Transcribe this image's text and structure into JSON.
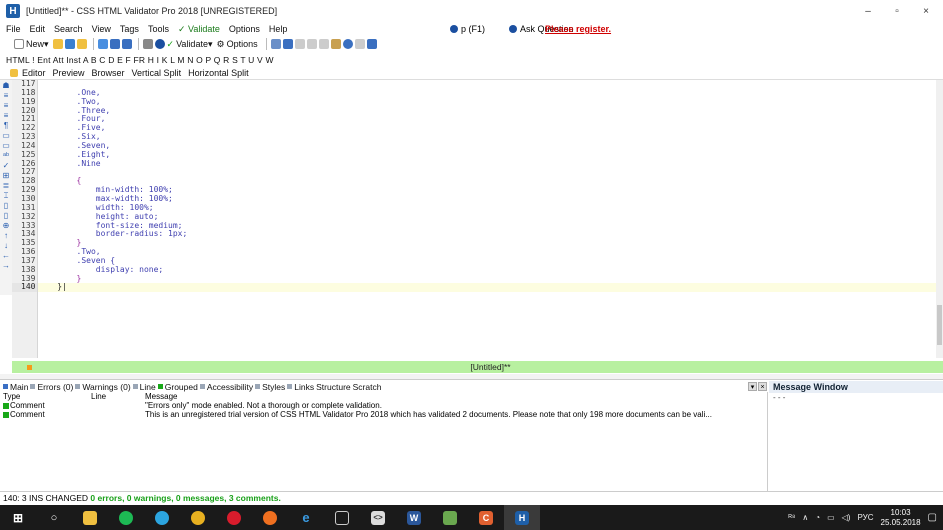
{
  "window": {
    "title": "[Untitled]** - CSS HTML Validator Pro 2018 [UNREGISTERED]",
    "app_icon_letter": "H",
    "minimize": "–",
    "maximize": "▫",
    "close": "×"
  },
  "menu": {
    "items": [
      "File",
      "Edit",
      "Search",
      "View",
      "Tags",
      "Tools",
      "✓ Validate",
      "Options",
      "Help"
    ],
    "p_label": "p (F1)",
    "ask_question": "Ask Question",
    "register": "Please register."
  },
  "toolbar": {
    "new_label": "New",
    "validate_label": "Validate",
    "options_label": "Options"
  },
  "letterbar": {
    "text": "HTML ! Ent Att Inst A B C D E F FR H I K L M N O P Q R S T U V W"
  },
  "tabs": [
    "Editor",
    "Preview",
    "Browser",
    "Vertical Split",
    "Horizontal Split"
  ],
  "editor": {
    "lines": [
      {
        "num": "117",
        "text": ""
      },
      {
        "num": "118",
        "text": "        .One,"
      },
      {
        "num": "119",
        "text": "        .Two,"
      },
      {
        "num": "120",
        "text": "        .Three,"
      },
      {
        "num": "121",
        "text": "        .Four,"
      },
      {
        "num": "122",
        "text": "        .Five,"
      },
      {
        "num": "123",
        "text": "        .Six,"
      },
      {
        "num": "124",
        "text": "        .Seven,"
      },
      {
        "num": "125",
        "text": "        .Eight,"
      },
      {
        "num": "126",
        "text": "        .Nine"
      },
      {
        "num": "127",
        "text": ""
      },
      {
        "num": "128",
        "text": "        {"
      },
      {
        "num": "129",
        "text": "            min-width: 100%;"
      },
      {
        "num": "130",
        "text": "            max-width: 100%;"
      },
      {
        "num": "131",
        "text": "            width: 100%;"
      },
      {
        "num": "132",
        "text": "            height: auto;"
      },
      {
        "num": "133",
        "text": "            font-size: medium;"
      },
      {
        "num": "134",
        "text": "            border-radius: 1px;"
      },
      {
        "num": "135",
        "text": "        }"
      },
      {
        "num": "136",
        "text": "        .Two,"
      },
      {
        "num": "137",
        "text": "        .Seven {"
      },
      {
        "num": "138",
        "text": "            display: none;"
      },
      {
        "num": "139",
        "text": "        }"
      },
      {
        "num": "140",
        "text": "    }|"
      }
    ],
    "current_line_index": 23,
    "doc_name": "[Untitled]**"
  },
  "bottom_tabs": [
    {
      "label": "Main",
      "color": "#3a6fc4"
    },
    {
      "label": "Errors (0)",
      "color": "#9aa6b6"
    },
    {
      "label": "Warnings (0)",
      "color": "#9aa6b6"
    },
    {
      "label": "Line",
      "color": "#9aa6b6"
    },
    {
      "label": "Grouped",
      "color": "#18a818"
    },
    {
      "label": "Accessibility",
      "color": "#9aa6b6"
    },
    {
      "label": "Styles",
      "color": "#9aa6b6"
    },
    {
      "label": "Links",
      "color": "#9aa6b6"
    },
    {
      "label": "Structure",
      "color": null
    },
    {
      "label": "Scratch",
      "color": null
    }
  ],
  "messages": {
    "headers": {
      "type": "Type",
      "line": "Line",
      "message": "Message"
    },
    "rows": [
      {
        "type": "Comment",
        "line": "",
        "message": "\"Errors only\" mode enabled. Not a thorough or complete validation."
      },
      {
        "type": "Comment",
        "line": "",
        "message": "This is an unregistered trial version of CSS HTML Validator Pro 2018 which has validated 2 documents. Please note that only 198 more documents can be vali..."
      }
    ]
  },
  "message_window": {
    "title": "Message Window",
    "body": "- - -"
  },
  "status": {
    "prefix": "140: 3  INS  CHANGED",
    "summary": "0 errors, 0 warnings, 0 messages, 3 comments."
  },
  "taskbar": {
    "lang": "РУС",
    "time": "10:03",
    "date": "25.05.2018"
  },
  "colors": {
    "docbar": "#b8f0a0",
    "code": "#4040b0",
    "brace": "#9b30a0",
    "register": "#d00000"
  }
}
